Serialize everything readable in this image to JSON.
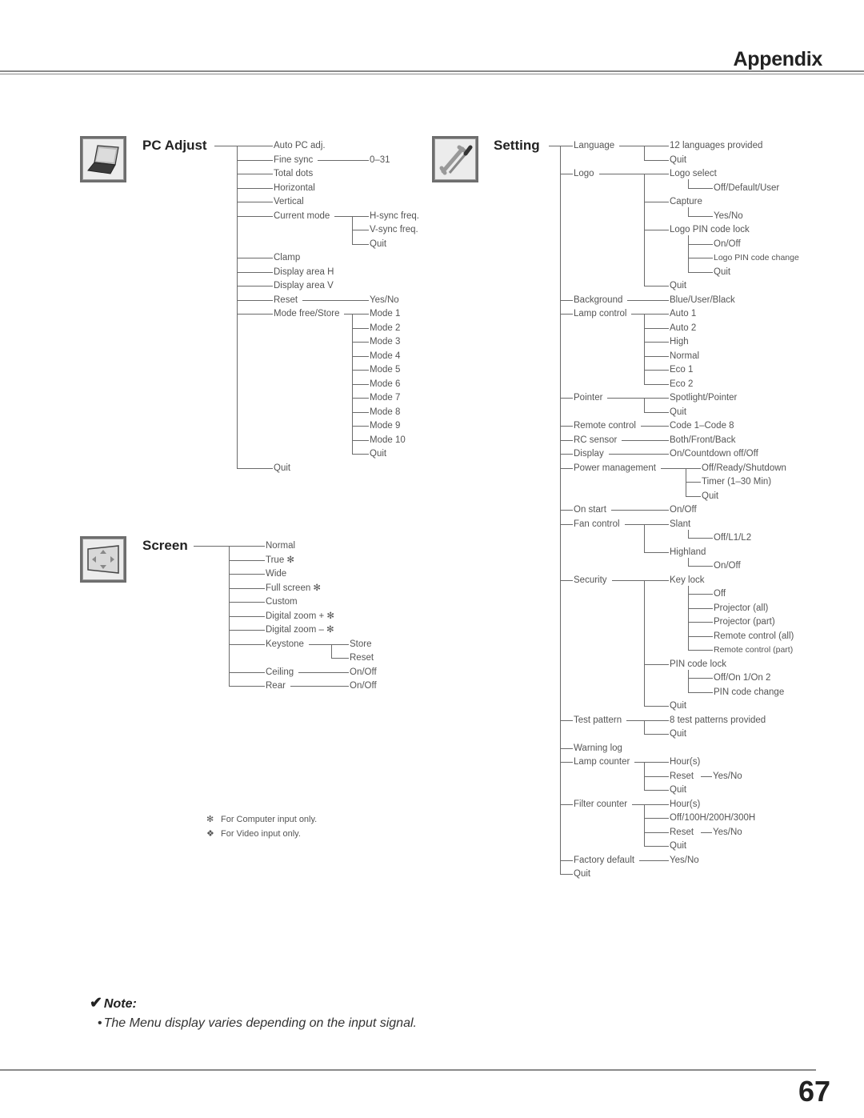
{
  "header": {
    "title": "Appendix"
  },
  "page_number": "67",
  "menus": [
    {
      "id": "pc-adjust",
      "title": "PC Adjust",
      "icon": "laptop-icon",
      "items": [
        {
          "label": "Auto PC adj."
        },
        {
          "label": "Fine sync",
          "children": [
            {
              "label": "0–31"
            }
          ]
        },
        {
          "label": "Total dots"
        },
        {
          "label": "Horizontal"
        },
        {
          "label": "Vertical"
        },
        {
          "label": "Current mode",
          "children": [
            {
              "label": "H-sync freq."
            },
            {
              "label": "V-sync freq."
            },
            {
              "label": "Quit"
            }
          ]
        },
        {
          "label": "Clamp"
        },
        {
          "label": "Display area H"
        },
        {
          "label": "Display area V"
        },
        {
          "label": "Reset",
          "children": [
            {
              "label": "Yes/No"
            }
          ]
        },
        {
          "label": "Mode free/Store",
          "children": [
            {
              "label": "Mode 1"
            },
            {
              "label": "Mode 2"
            },
            {
              "label": "Mode 3"
            },
            {
              "label": "Mode 4"
            },
            {
              "label": "Mode 5"
            },
            {
              "label": "Mode 6"
            },
            {
              "label": "Mode 7"
            },
            {
              "label": "Mode 8"
            },
            {
              "label": "Mode 9"
            },
            {
              "label": "Mode 10"
            },
            {
              "label": "Quit"
            }
          ]
        },
        {
          "label": "Quit"
        }
      ]
    },
    {
      "id": "screen",
      "title": "Screen",
      "icon": "screen-arrows-icon",
      "items": [
        {
          "label": "Normal"
        },
        {
          "label": "True ✻"
        },
        {
          "label": "Wide"
        },
        {
          "label": "Full screen ✻"
        },
        {
          "label": "Custom"
        },
        {
          "label": "Digital zoom + ✻"
        },
        {
          "label": "Digital zoom – ✻"
        },
        {
          "label": "Keystone",
          "children": [
            {
              "label": "Store"
            },
            {
              "label": "Reset"
            }
          ]
        },
        {
          "label": "Ceiling",
          "children": [
            {
              "label": "On/Off"
            }
          ]
        },
        {
          "label": "Rear",
          "children": [
            {
              "label": "On/Off"
            }
          ]
        }
      ]
    },
    {
      "id": "setting",
      "title": "Setting",
      "icon": "wrench-screwdriver-icon",
      "items": [
        {
          "label": "Language",
          "children": [
            {
              "label": "12 languages provided"
            },
            {
              "label": "Quit"
            }
          ]
        },
        {
          "label": "Logo",
          "children": [
            {
              "label": "Logo select",
              "children": [
                {
                  "label": "Off/Default/User"
                }
              ]
            },
            {
              "label": "Capture",
              "children": [
                {
                  "label": "Yes/No"
                }
              ]
            },
            {
              "label": "Logo PIN code lock",
              "children": [
                {
                  "label": "On/Off"
                },
                {
                  "label": "Logo PIN code change",
                  "small": true
                },
                {
                  "label": "Quit"
                }
              ]
            },
            {
              "label": "Quit"
            }
          ]
        },
        {
          "label": "Background",
          "children": [
            {
              "label": "Blue/User/Black"
            }
          ]
        },
        {
          "label": "Lamp control",
          "children": [
            {
              "label": "Auto 1"
            },
            {
              "label": "Auto 2"
            },
            {
              "label": "High"
            },
            {
              "label": "Normal"
            },
            {
              "label": "Eco 1"
            },
            {
              "label": "Eco 2"
            }
          ]
        },
        {
          "label": "Pointer",
          "children": [
            {
              "label": "Spotlight/Pointer"
            },
            {
              "label": "Quit"
            }
          ]
        },
        {
          "label": "Remote control",
          "children": [
            {
              "label": "Code 1–Code 8"
            }
          ]
        },
        {
          "label": "RC sensor",
          "children": [
            {
              "label": "Both/Front/Back"
            }
          ]
        },
        {
          "label": "Display",
          "children": [
            {
              "label": "On/Countdown off/Off"
            }
          ]
        },
        {
          "label": "Power management",
          "children": [
            {
              "label": "Off/Ready/Shutdown"
            },
            {
              "label": "Timer (1–30 Min)"
            },
            {
              "label": "Quit"
            }
          ]
        },
        {
          "label": "On start",
          "children": [
            {
              "label": "On/Off"
            }
          ]
        },
        {
          "label": "Fan control",
          "children": [
            {
              "label": "Slant",
              "children": [
                {
                  "label": "Off/L1/L2"
                }
              ]
            },
            {
              "label": "Highland",
              "children": [
                {
                  "label": "On/Off"
                }
              ]
            }
          ]
        },
        {
          "label": "Security",
          "children": [
            {
              "label": "Key lock",
              "children": [
                {
                  "label": "Off"
                },
                {
                  "label": "Projector (all)"
                },
                {
                  "label": "Projector (part)"
                },
                {
                  "label": "Remote control (all)"
                },
                {
                  "label": "Remote control (part)",
                  "small": true
                }
              ]
            },
            {
              "label": "PIN code lock",
              "children": [
                {
                  "label": "Off/On 1/On 2"
                },
                {
                  "label": "PIN code change"
                }
              ]
            },
            {
              "label": "Quit"
            }
          ]
        },
        {
          "label": "Test pattern",
          "children": [
            {
              "label": "8 test patterns provided"
            },
            {
              "label": "Quit"
            }
          ]
        },
        {
          "label": "Warning log"
        },
        {
          "label": "Lamp counter",
          "children": [
            {
              "label": "Hour(s)"
            },
            {
              "label": "Reset",
              "inline": "Yes/No"
            },
            {
              "label": "Quit"
            }
          ]
        },
        {
          "label": "Filter counter",
          "children": [
            {
              "label": "Hour(s)"
            },
            {
              "label": "Off/100H/200H/300H"
            },
            {
              "label": "Reset",
              "inline": "Yes/No"
            },
            {
              "label": "Quit"
            }
          ]
        },
        {
          "label": "Factory default",
          "children": [
            {
              "label": "Yes/No"
            }
          ]
        },
        {
          "label": "Quit"
        }
      ]
    }
  ],
  "footnotes": [
    {
      "symbol": "✻",
      "text": "For Computer input only."
    },
    {
      "symbol": "❖",
      "text": "For Video input only."
    }
  ],
  "note": {
    "heading": "Note:",
    "check": "✔",
    "bullet": "•",
    "text": "The Menu display varies depending on the input signal."
  }
}
